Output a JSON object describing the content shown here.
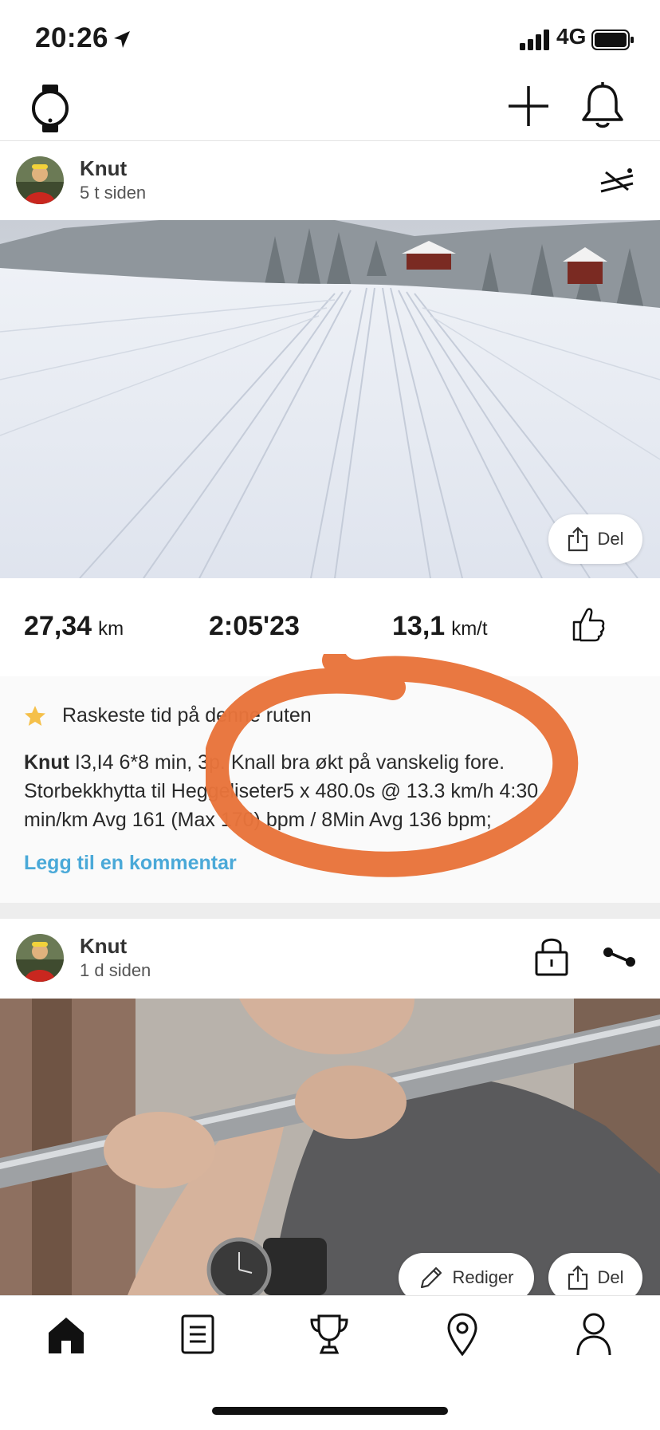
{
  "status_bar": {
    "time": "20:26",
    "network": "4G"
  },
  "top_bar": {
    "icons": [
      "watch-icon",
      "plus-icon",
      "bell-icon"
    ]
  },
  "posts": [
    {
      "user": "Knut",
      "time_ago": "5 t siden",
      "share_label": "Del",
      "stats": {
        "distance_value": "27,34",
        "distance_unit": "km",
        "duration": "2:05'23",
        "speed_value": "13,1",
        "speed_unit": "km/t"
      },
      "achievement": "Raskeste tid på denne ruten",
      "description_author": "Knut",
      "description_lines": [
        " I3,I4   6*8 min, 3p. Knall bra økt på vanskelig fore.",
        "Storbekkhytta til Heggeliseter5 x 480.0s @ 13.3 km/h   4:30",
        "min/km Avg 161 (Max 170) bpm /    8Min Avg 136 bpm;"
      ],
      "comment_link": "Legg til en kommentar"
    },
    {
      "user": "Knut",
      "time_ago": "1 d siden",
      "edit_label": "Rediger",
      "share_label": "Del"
    }
  ],
  "bottom_nav": [
    "home-icon",
    "diary-icon",
    "trophy-icon",
    "map-pin-icon",
    "profile-icon"
  ],
  "colors": {
    "link": "#4aa9d8",
    "annotation": "#e8743b",
    "star": "#f5c04a"
  }
}
